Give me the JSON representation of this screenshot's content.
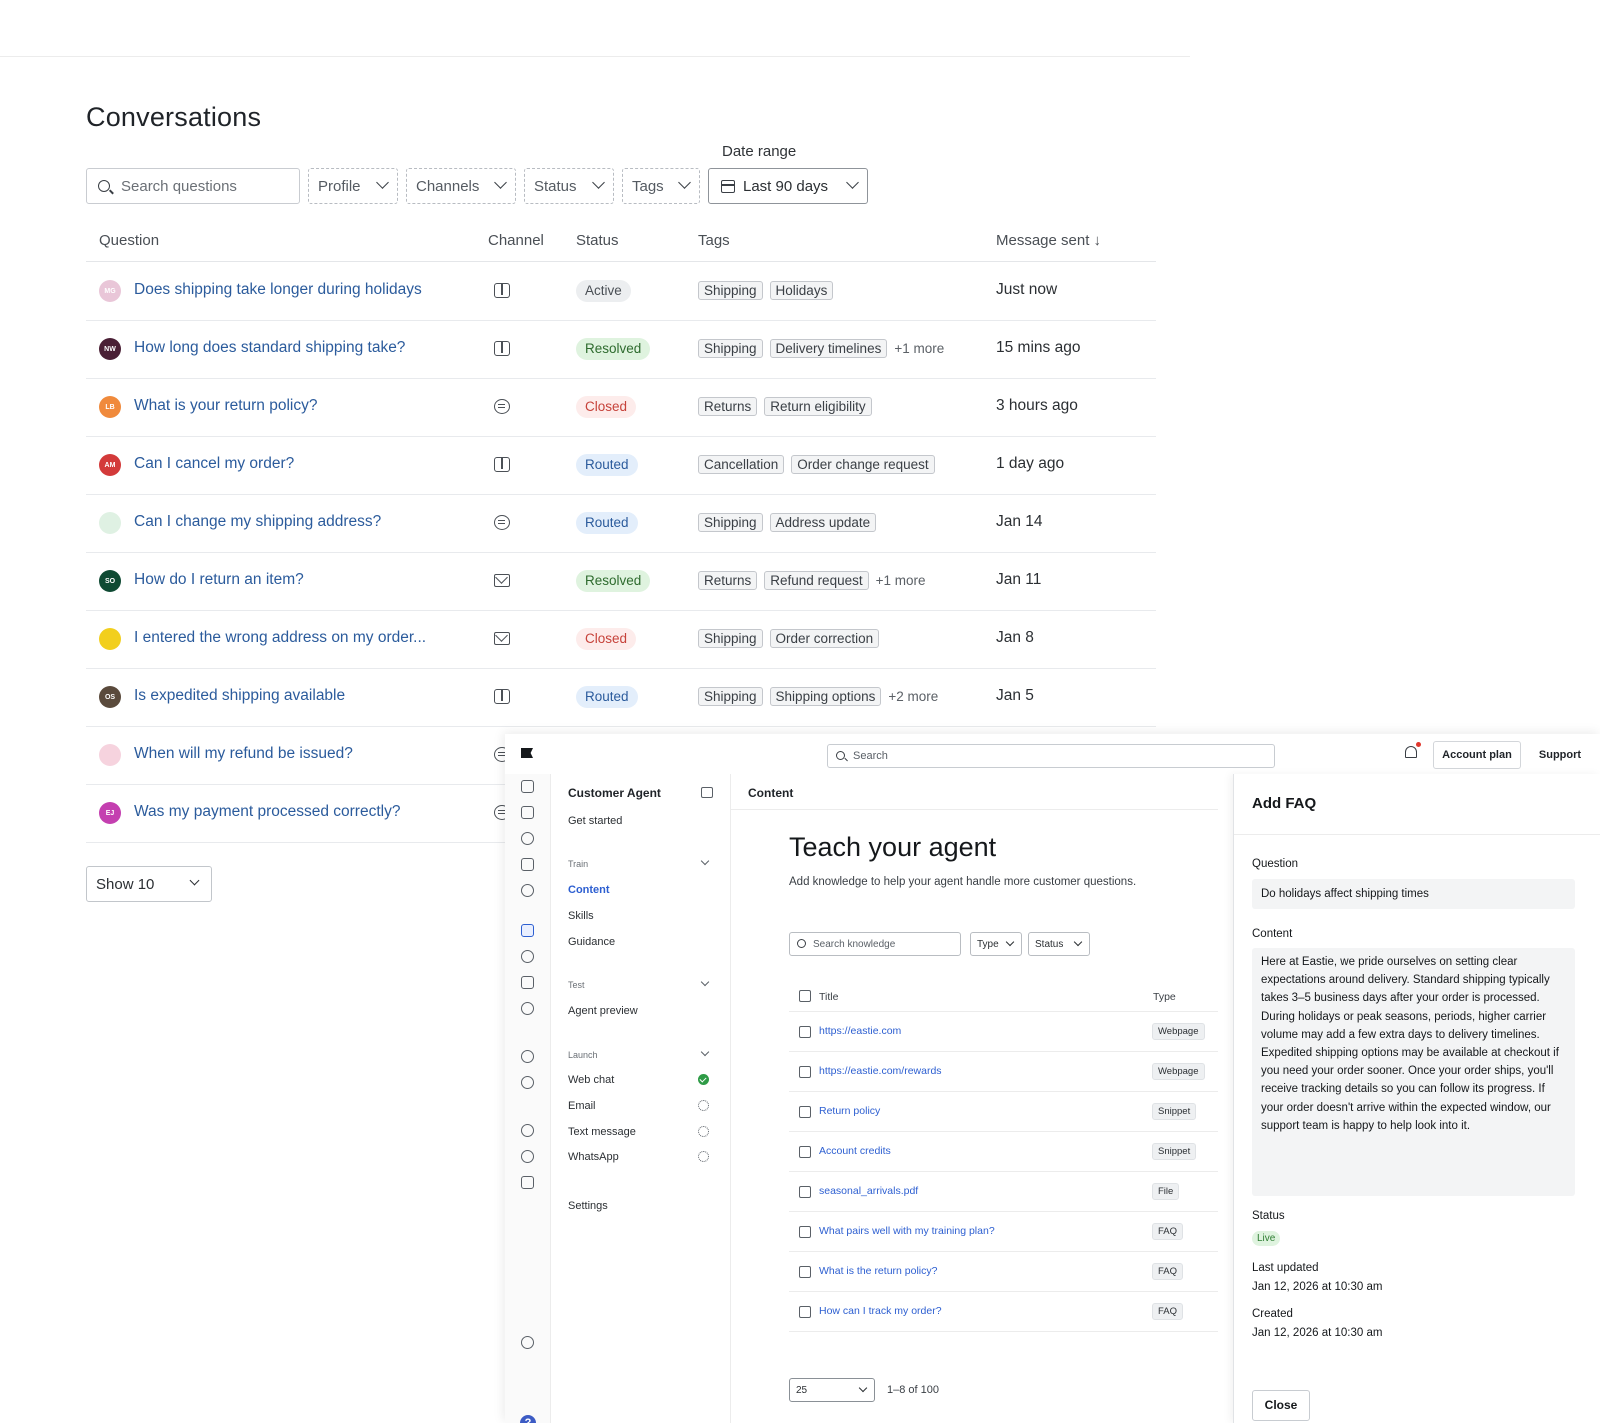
{
  "conversations": {
    "title": "Conversations",
    "date_range_label": "Date range",
    "filters": {
      "search_placeholder": "Search questions",
      "profile": "Profile",
      "channels": "Channels",
      "status": "Status",
      "tags": "Tags",
      "date_range": "Last 90 days"
    },
    "columns": {
      "question": "Question",
      "channel": "Channel",
      "status": "Status",
      "tags": "Tags",
      "message_sent": "Message sent ↓"
    },
    "rows": [
      {
        "initials": "MG",
        "avatar_color": "#e9c6d8",
        "question": "Does shipping take longer during holidays",
        "channel_icon": "web-icon",
        "status": "Active",
        "tags": [
          "Shipping",
          "Holidays"
        ],
        "more": "",
        "sent": "Just now"
      },
      {
        "initials": "NW",
        "avatar_color": "#4a1f35",
        "question": "How long does standard shipping take?",
        "channel_icon": "web-icon",
        "status": "Resolved",
        "tags": [
          "Shipping",
          "Delivery timelines"
        ],
        "more": "+1 more",
        "sent": "15 mins ago"
      },
      {
        "initials": "LB",
        "avatar_color": "#f08a3c",
        "question": "What is your return policy?",
        "channel_icon": "chat-icon",
        "status": "Closed",
        "tags": [
          "Returns",
          "Return eligibility"
        ],
        "more": "",
        "sent": "3 hours ago"
      },
      {
        "initials": "AM",
        "avatar_color": "#d33a3a",
        "question": "Can I cancel my order?",
        "channel_icon": "web-icon",
        "status": "Routed",
        "tags": [
          "Cancellation",
          "Order change request"
        ],
        "more": "",
        "sent": "1 day ago"
      },
      {
        "initials": "",
        "avatar_color": "#dff1e3",
        "question": "Can I change my shipping address?",
        "channel_icon": "chat-icon",
        "status": "Routed",
        "tags": [
          "Shipping",
          "Address update"
        ],
        "more": "",
        "sent": "Jan 14"
      },
      {
        "initials": "SO",
        "avatar_color": "#0f4a33",
        "question": "How do I return an item?",
        "channel_icon": "mail-icon",
        "status": "Resolved",
        "tags": [
          "Returns",
          "Refund request"
        ],
        "more": "+1 more",
        "sent": "Jan 11"
      },
      {
        "initials": "",
        "avatar_color": "#f2cf1d",
        "question": "I entered the wrong address on my order...",
        "channel_icon": "mail-icon",
        "status": "Closed",
        "tags": [
          "Shipping",
          "Order correction"
        ],
        "more": "",
        "sent": "Jan 8"
      },
      {
        "initials": "OS",
        "avatar_color": "#5a4a3c",
        "question": "Is expedited shipping available",
        "channel_icon": "web-icon",
        "status": "Routed",
        "tags": [
          "Shipping",
          "Shipping options"
        ],
        "more": "+2 more",
        "sent": "Jan 5"
      },
      {
        "initials": "",
        "avatar_color": "#f6d3de",
        "question": "When will my refund be issued?",
        "channel_icon": "chat-icon",
        "status": "",
        "tags": [],
        "more": "",
        "sent": ""
      },
      {
        "initials": "EJ",
        "avatar_color": "#c43fb0",
        "question": "Was my payment processed correctly?",
        "channel_icon": "chat-icon",
        "status": "",
        "tags": [],
        "more": "",
        "sent": ""
      }
    ],
    "page_size": "Show 10"
  },
  "agent_app": {
    "search_placeholder": "Search",
    "account_plan": "Account plan",
    "support": "Support",
    "nav": {
      "title": "Customer Agent",
      "get_started": "Get started",
      "train_section": "Train",
      "content": "Content",
      "skills": "Skills",
      "guidance": "Guidance",
      "test_section": "Test",
      "agent_preview": "Agent preview",
      "launch_section": "Launch",
      "web_chat": "Web chat",
      "email": "Email",
      "text_message": "Text message",
      "whatsapp": "WhatsApp",
      "settings": "Settings"
    },
    "content": {
      "header": "Content",
      "title": "Teach your agent",
      "subtitle": "Add knowledge to help your agent handle more customer questions.",
      "search_placeholder": "Search knowledge",
      "type_filter": "Type",
      "status_filter": "Status",
      "col_title": "Title",
      "col_type": "Type",
      "items": [
        {
          "title": "https://eastie.com",
          "type": "Webpage"
        },
        {
          "title": "https://eastie.com/rewards",
          "type": "Webpage"
        },
        {
          "title": "Return policy",
          "type": "Snippet"
        },
        {
          "title": "Account credits",
          "type": "Snippet"
        },
        {
          "title": "seasonal_arrivals.pdf",
          "type": "File"
        },
        {
          "title": "What pairs well with my training plan?",
          "type": "FAQ"
        },
        {
          "title": "What is the return policy?",
          "type": "FAQ"
        },
        {
          "title": "How can I track my order?",
          "type": "FAQ"
        }
      ],
      "page_size": "25",
      "range": "1–8 of 100"
    },
    "faq_panel": {
      "title": "Add FAQ",
      "question_label": "Question",
      "question_value": "Do holidays affect shipping times",
      "content_label": "Content",
      "content_value": "Here at Eastie, we pride ourselves on setting clear expectations around delivery. Standard shipping typically takes 3–5 business days after your order is processed. During holidays or peak seasons, periods, higher carrier volume may add a few extra days to delivery timelines. Expedited shipping options may be available at checkout if you need your order sooner. Once your order ships, you'll receive tracking details so you can follow its progress. If your order doesn't arrive within the expected window, our support team is happy to help look into it.",
      "status_label": "Status",
      "status_value": "Live",
      "last_updated_label": "Last updated",
      "last_updated_value": "Jan 12, 2026 at 10:30 am",
      "created_label": "Created",
      "created_value": "Jan 12, 2026 at 10:30 am",
      "close": "Close"
    }
  }
}
